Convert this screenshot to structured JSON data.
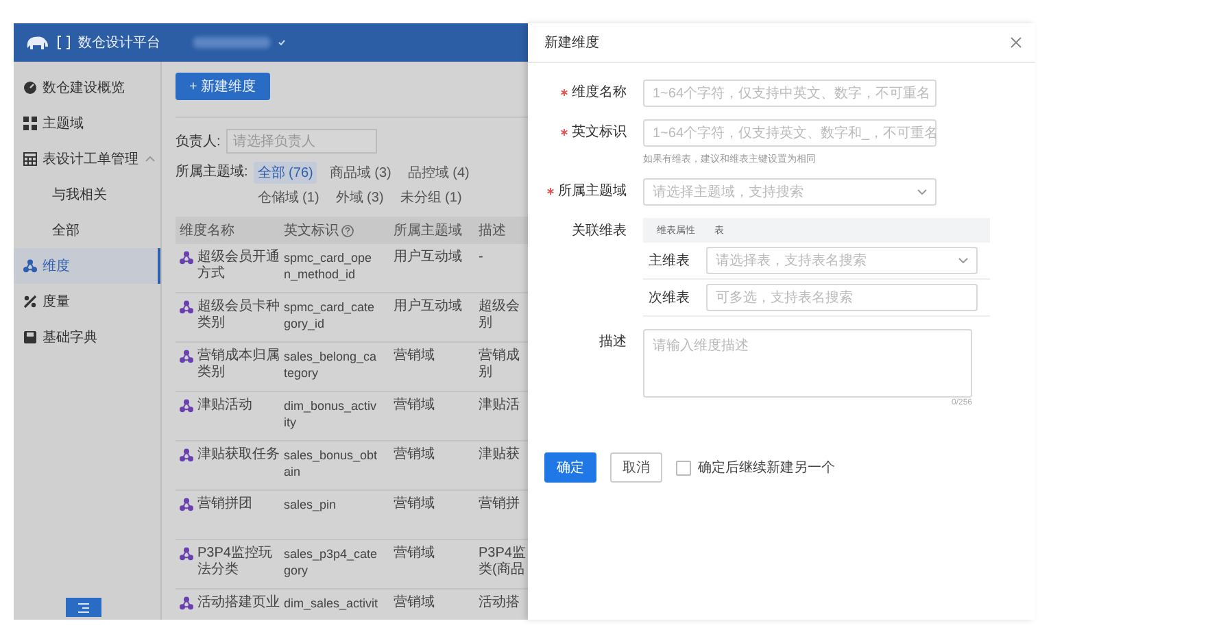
{
  "header": {
    "logo_text": "数仓设计平台"
  },
  "sidebar": {
    "items": [
      {
        "label": "数仓建设概览",
        "selected": false
      },
      {
        "label": "主题域",
        "selected": false
      },
      {
        "label": "表设计工单管理",
        "selected": false,
        "expanded": true,
        "children": [
          {
            "label": "与我相关",
            "selected": false
          },
          {
            "label": "全部",
            "selected": false
          }
        ]
      },
      {
        "label": "维度",
        "selected": true
      },
      {
        "label": "度量",
        "selected": false
      },
      {
        "label": "基础字典",
        "selected": false
      }
    ]
  },
  "toolbar": {
    "new_button": "+ 新建维度",
    "owner_label": "负责人:",
    "owner_placeholder": "请选择负责人",
    "domain_label": "所属主题域:"
  },
  "domain_filters": [
    {
      "label": "全部 (76)",
      "selected": true
    },
    {
      "label": "商品域 (3)",
      "selected": false
    },
    {
      "label": "品控域 (4)",
      "selected": false
    },
    {
      "label": "仓储域 (1)",
      "selected": false
    },
    {
      "label": "外域 (3)",
      "selected": false
    },
    {
      "label": "未分组 (1)",
      "selected": false
    }
  ],
  "table": {
    "columns": [
      "维度名称",
      "英文标识",
      "所属主题域",
      "描述"
    ],
    "rows": [
      {
        "name": [
          "超级会员开通",
          "方式"
        ],
        "en": [
          "spmc_card_ope",
          "n_method_id"
        ],
        "domain": "用户互动域",
        "desc": [
          "-"
        ]
      },
      {
        "name": [
          "超级会员卡种",
          "类别"
        ],
        "en": [
          "spmc_card_cate",
          "gory_id"
        ],
        "domain": "用户互动域",
        "desc": [
          "超级会",
          "别"
        ]
      },
      {
        "name": [
          "营销成本归属",
          "类别"
        ],
        "en": [
          "sales_belong_ca",
          "tegory"
        ],
        "domain": "营销域",
        "desc": [
          "营销成",
          "别"
        ]
      },
      {
        "name": [
          "津贴活动"
        ],
        "en": [
          "dim_bonus_activ",
          "ity"
        ],
        "domain": "营销域",
        "desc": [
          "津贴活"
        ]
      },
      {
        "name": [
          "津贴获取任务"
        ],
        "en": [
          "sales_bonus_obt",
          "ain"
        ],
        "domain": "营销域",
        "desc": [
          "津贴获"
        ]
      },
      {
        "name": [
          "营销拼团"
        ],
        "en": [
          "sales_pin"
        ],
        "domain": "营销域",
        "desc": [
          "营销拼"
        ]
      },
      {
        "name": [
          "P3P4监控玩",
          "法分类"
        ],
        "en": [
          "sales_p3p4_cate",
          "gory"
        ],
        "domain": "营销域",
        "desc": [
          "P3P4监",
          "类(商品"
        ]
      },
      {
        "name": [
          "活动搭建页业"
        ],
        "en": [
          "dim_sales_activit"
        ],
        "domain": "营销域",
        "desc": [
          "活动搭"
        ]
      }
    ]
  },
  "drawer": {
    "title": "新建维度",
    "fields": [
      {
        "kind": "input",
        "label": "维度名称",
        "required": true,
        "placeholder": "1~64个字符，仅支持中英文、数字，不可重名"
      },
      {
        "kind": "input",
        "label": "英文标识",
        "required": true,
        "placeholder": "1~64个字符，仅支持英文、数字和_，不可重名",
        "hint": "如果有维表，建议和维表主键设置为相同"
      },
      {
        "kind": "select",
        "label": "所属主题域",
        "required": true,
        "placeholder": "请选择主题域，支持搜索"
      }
    ],
    "link_table": {
      "label": "关联维表",
      "headers": [
        "维表属性",
        "表"
      ],
      "rows": [
        {
          "kind": "select",
          "label": "主维表",
          "placeholder": "请选择表，支持表名搜索"
        },
        {
          "kind": "input",
          "label": "次维表",
          "placeholder": "可多选，支持表名搜索"
        }
      ]
    },
    "description": {
      "label": "描述",
      "placeholder": "请输入维度描述",
      "counter": "0/256"
    },
    "confirm_button": "确定",
    "cancel_button": "取消",
    "continue_checkbox": {
      "label": "确定后继续新建另一个",
      "checked": false
    }
  }
}
